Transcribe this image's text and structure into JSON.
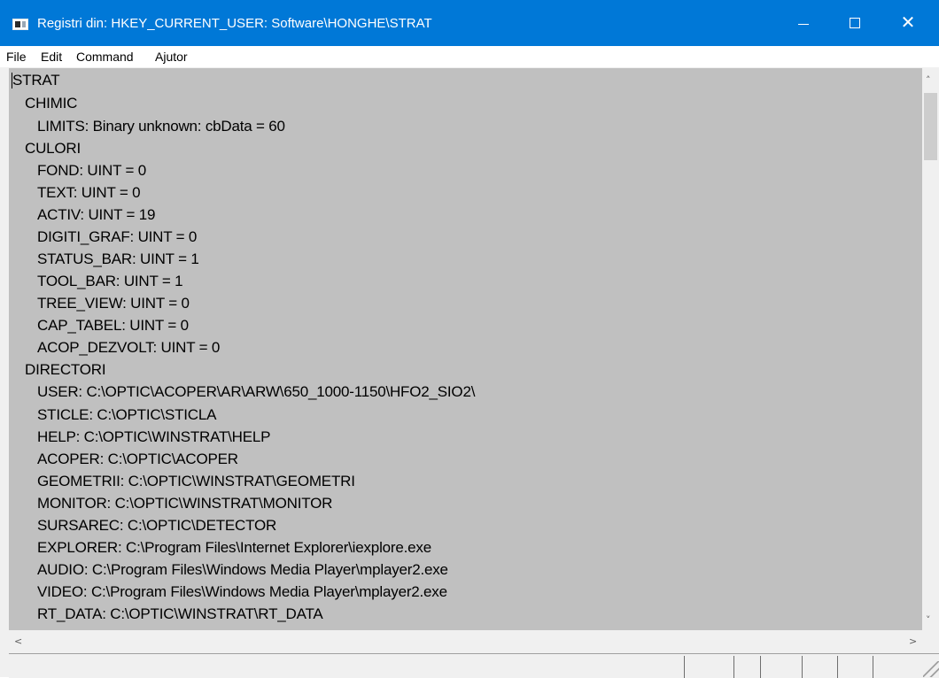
{
  "window": {
    "title": "Registri din: HKEY_CURRENT_USER: Software\\HONGHE\\STRAT",
    "close_glyph": "✕"
  },
  "menu": [
    "File",
    "Edit",
    "Command",
    "Ajutor"
  ],
  "content": {
    "lines": [
      "STRAT",
      "CHIMIC",
      "LIMITS: Binary unknown: cbData = 60",
      "CULORI",
      "FOND: UINT = 0",
      "TEXT: UINT = 0",
      "ACTIV: UINT = 19",
      "DIGITI_GRAF: UINT = 0",
      "STATUS_BAR: UINT = 1",
      "TOOL_BAR: UINT = 1",
      "TREE_VIEW: UINT = 0",
      "CAP_TABEL: UINT = 0",
      "ACOP_DEZVOLT: UINT = 0",
      "DIRECTORI",
      "USER: C:\\OPTIC\\ACOPER\\AR\\ARW\\650_1000-1150\\HFO2_SIO2\\",
      "STICLE: C:\\OPTIC\\STICLA",
      "HELP: C:\\OPTIC\\WINSTRAT\\HELP",
      "ACOPER: C:\\OPTIC\\ACOPER",
      "GEOMETRII: C:\\OPTIC\\WINSTRAT\\GEOMETRI",
      "MONITOR: C:\\OPTIC\\WINSTRAT\\MONITOR",
      "SURSAREC: C:\\OPTIC\\DETECTOR",
      "EXPLORER: C:\\Program Files\\Internet Explorer\\iexplore.exe",
      "AUDIO: C:\\Program Files\\Windows Media Player\\mplayer2.exe",
      "VIDEO: C:\\Program Files\\Windows Media Player\\mplayer2.exe",
      "RT_DATA: C:\\OPTIC\\WINSTRAT\\RT_DATA"
    ]
  },
  "scrollbars": {
    "up_glyph": "˄",
    "down_glyph": "˅",
    "left_glyph": "<",
    "right_glyph": ">"
  },
  "colors": {
    "titlebar": "#0078d7",
    "content_background": "#c0c0c0"
  }
}
